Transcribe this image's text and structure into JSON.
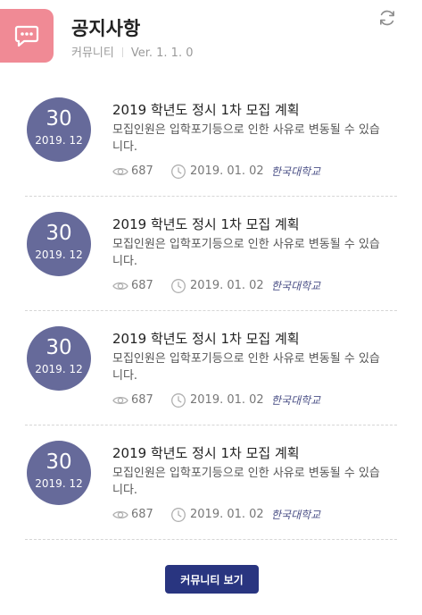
{
  "header": {
    "title": "공지사항",
    "category": "커뮤니티",
    "version": "Ver. 1. 1. 0",
    "icon": "chat-bubble-icon",
    "refresh_icon": "refresh-icon",
    "accent_color": "#f08a95"
  },
  "notices": [
    {
      "day": "30",
      "month": "2019. 12",
      "title": "2019 학년도 정시 1차 모집 계획",
      "desc": "모집인원은 입학포기등으로 인한 사유로 변동될 수 있습니다.",
      "views": "687",
      "date": "2019. 01. 02",
      "author": "한국대학교"
    },
    {
      "day": "30",
      "month": "2019. 12",
      "title": "2019 학년도 정시 1차 모집 계획",
      "desc": "모집인원은 입학포기등으로 인한 사유로 변동될 수 있습니다.",
      "views": "687",
      "date": "2019. 01. 02",
      "author": "한국대학교"
    },
    {
      "day": "30",
      "month": "2019. 12",
      "title": "2019 학년도 정시 1차 모집 계획",
      "desc": "모집인원은 입학포기등으로 인한 사유로 변동될 수 있습니다.",
      "views": "687",
      "date": "2019. 01. 02",
      "author": "한국대학교"
    },
    {
      "day": "30",
      "month": "2019. 12",
      "title": "2019 학년도 정시 1차 모집 계획",
      "desc": "모집인원은 입학포기등으로 인한 사유로 변동될 수 있습니다.",
      "views": "687",
      "date": "2019. 01. 02",
      "author": "한국대학교"
    }
  ],
  "footer": {
    "button_label": "커뮤니티 보기",
    "button_color": "#293580"
  },
  "colors": {
    "date_circle": "#666a9a",
    "author": "#4a4f86"
  }
}
